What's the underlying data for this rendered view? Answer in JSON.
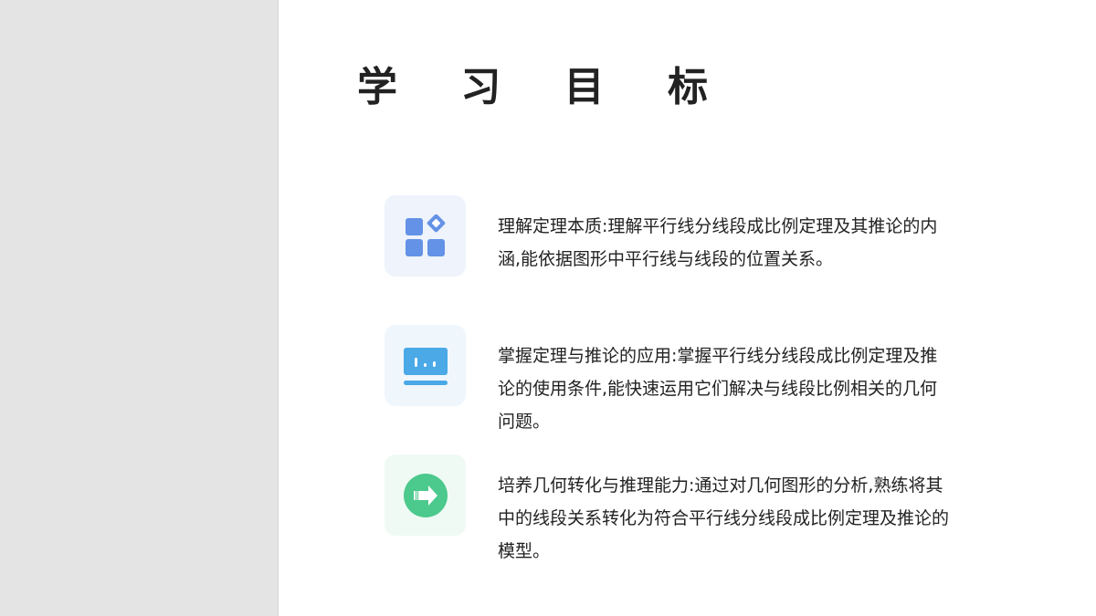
{
  "title": "学 习 目 标",
  "colors": {
    "sidebar": "#e4e4e4",
    "icon_blue": "#6492e6",
    "icon_cyan": "#4aa9e6",
    "icon_green": "#4cc98c"
  },
  "goals": [
    {
      "icon": "grid-apps-icon",
      "text": "理解定理本质:理解平行线分线段成比例定理及其推论的内涵,能依据图形中平行线与线段的位置关系。"
    },
    {
      "icon": "chart-board-icon",
      "text": "掌握定理与推论的应用:掌握平行线分线段成比例定理及推论的使用条件,能快速运用它们解决与线段比例相关的几何问题。"
    },
    {
      "icon": "arrow-circle-icon",
      "text": "培养几何转化与推理能力:通过对几何图形的分析,熟练将其中的线段关系转化为符合平行线分线段成比例定理及推论的模型。"
    }
  ]
}
